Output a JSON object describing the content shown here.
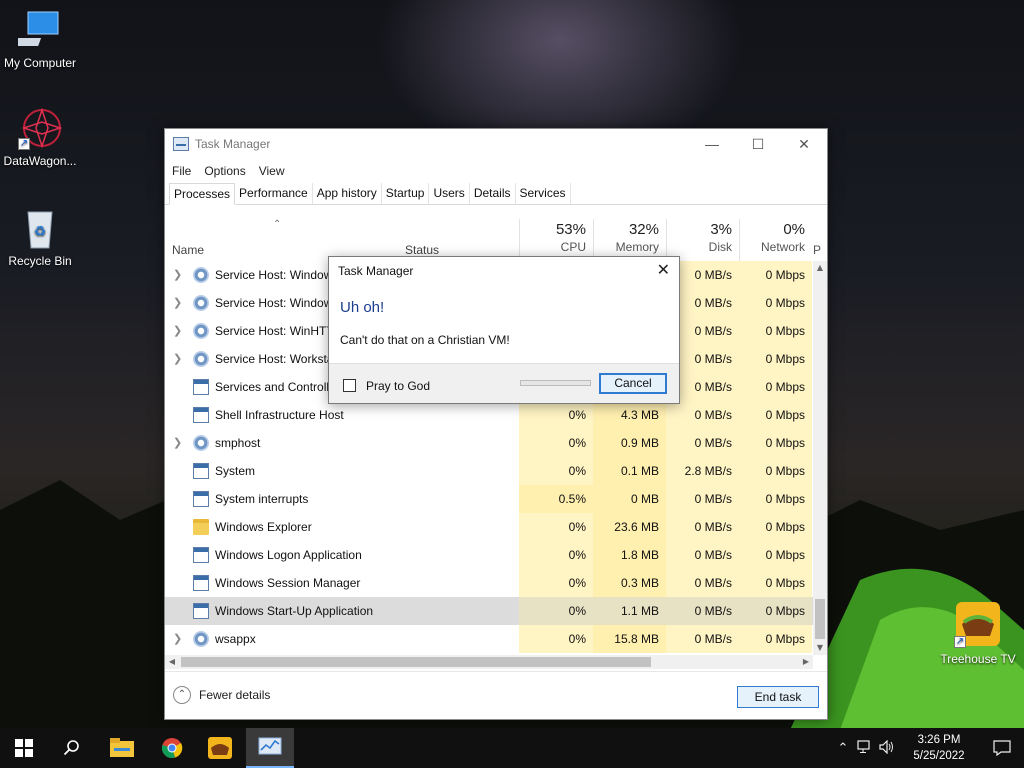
{
  "desktop": {
    "icons": [
      {
        "label": "My Computer"
      },
      {
        "label": "DataWagon..."
      },
      {
        "label": "Recycle Bin"
      },
      {
        "label": "Treehouse TV"
      }
    ]
  },
  "window": {
    "title": "Task Manager",
    "menu": [
      "File",
      "Options",
      "View"
    ],
    "tabs": [
      "Processes",
      "Performance",
      "App history",
      "Startup",
      "Users",
      "Details",
      "Services"
    ],
    "active_tab": "Processes",
    "columns": {
      "name": "Name",
      "status": "Status",
      "cpu": {
        "pct": "53%",
        "label": "CPU"
      },
      "memory": {
        "pct": "32%",
        "label": "Memory"
      },
      "disk": {
        "pct": "3%",
        "label": "Disk"
      },
      "network": {
        "pct": "0%",
        "label": "Network"
      },
      "truncated": "P"
    },
    "rows": [
      {
        "expand": true,
        "icon": "gear-icon",
        "name": "Service Host: Windows",
        "cpu": "",
        "mem": "",
        "disk": "0 MB/s",
        "net": "0 Mbps"
      },
      {
        "expand": true,
        "icon": "gear-icon",
        "name": "Service Host: Windows",
        "cpu": "",
        "mem": "",
        "disk": "0 MB/s",
        "net": "0 Mbps"
      },
      {
        "expand": true,
        "icon": "gear-icon",
        "name": "Service Host: WinHTTP",
        "cpu": "",
        "mem": "",
        "disk": "0 MB/s",
        "net": "0 Mbps"
      },
      {
        "expand": true,
        "icon": "gear-icon",
        "name": "Service Host: Workstation",
        "cpu": "",
        "mem": "",
        "disk": "0 MB/s",
        "net": "0 Mbps"
      },
      {
        "expand": false,
        "icon": "window-icon",
        "name": "Services and Controller app",
        "cpu": "",
        "mem": "",
        "disk": "0 MB/s",
        "net": "0 Mbps"
      },
      {
        "expand": false,
        "icon": "window-icon",
        "name": "Shell Infrastructure Host",
        "cpu": "0%",
        "mem": "4.3 MB",
        "disk": "0 MB/s",
        "net": "0 Mbps"
      },
      {
        "expand": true,
        "icon": "gear-icon",
        "name": "smphost",
        "cpu": "0%",
        "mem": "0.9 MB",
        "disk": "0 MB/s",
        "net": "0 Mbps"
      },
      {
        "expand": false,
        "icon": "window-icon",
        "name": "System",
        "cpu": "0%",
        "mem": "0.1 MB",
        "disk": "2.8 MB/s",
        "net": "0 Mbps"
      },
      {
        "expand": false,
        "icon": "window-icon",
        "name": "System interrupts",
        "cpu": "0.5%",
        "mem": "0 MB",
        "disk": "0 MB/s",
        "net": "0 Mbps"
      },
      {
        "expand": false,
        "icon": "folder-icon",
        "name": "Windows Explorer",
        "cpu": "0%",
        "mem": "23.6 MB",
        "disk": "0 MB/s",
        "net": "0 Mbps"
      },
      {
        "expand": false,
        "icon": "window-icon",
        "name": "Windows Logon Application",
        "cpu": "0%",
        "mem": "1.8 MB",
        "disk": "0 MB/s",
        "net": "0 Mbps"
      },
      {
        "expand": false,
        "icon": "window-icon",
        "name": "Windows Session Manager",
        "cpu": "0%",
        "mem": "0.3 MB",
        "disk": "0 MB/s",
        "net": "0 Mbps"
      },
      {
        "expand": false,
        "icon": "window-icon",
        "name": "Windows Start-Up Application",
        "cpu": "0%",
        "mem": "1.1 MB",
        "disk": "0 MB/s",
        "net": "0 Mbps",
        "selected": true
      },
      {
        "expand": true,
        "icon": "gear-icon",
        "name": "wsappx",
        "cpu": "0%",
        "mem": "15.8 MB",
        "disk": "0 MB/s",
        "net": "0 Mbps"
      }
    ],
    "fewer_details": "Fewer details",
    "end_task": "End task"
  },
  "dialog": {
    "title": "Task Manager",
    "heading": "Uh oh!",
    "message": "Can't do that on a Christian VM!",
    "checkbox_label": "Pray to God",
    "progress_fraction": 0,
    "cancel": "Cancel"
  },
  "taskbar": {
    "time": "3:26 PM",
    "date": "5/25/2022"
  },
  "colors": {
    "accent": "#2f7bd1",
    "heat_light": "#fff4c4",
    "heat_medium": "#fff0b0",
    "dialog_heading": "#1b3d8f"
  }
}
